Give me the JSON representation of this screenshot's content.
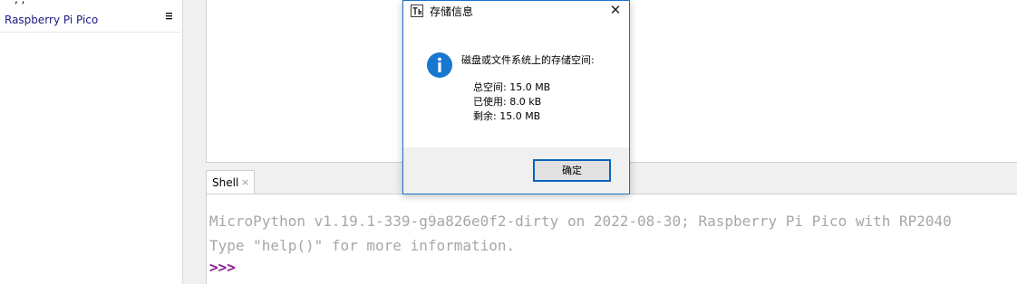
{
  "files_panel": {
    "partial_top_text": "—, ,",
    "device_label": "Raspberry Pi Pico",
    "device_menu_icon": "hamburger-menu-icon"
  },
  "shell_tab": {
    "label": "Shell",
    "close": "×"
  },
  "shell": {
    "lines": [
      "MicroPython v1.19.1-339-g9a826e0f2-dirty on 2022-08-30; Raspberry Pi Pico with RP2040",
      "Type \"help()\" for more information."
    ],
    "prompt": ">>>",
    "prompt_color": "#8a1a8a"
  },
  "dialog": {
    "title": "存储信息",
    "close": "✕",
    "app_icon": "thonny-icon",
    "info_icon": "info-icon",
    "heading": "磁盘或文件系统上的存储空间:",
    "total": "总空间: 15.0 MB",
    "used": "已使用: 8.0 kB",
    "free": "剩余: 15.0 MB",
    "ok_label": "确定",
    "accent_color": "#1a73c9"
  }
}
